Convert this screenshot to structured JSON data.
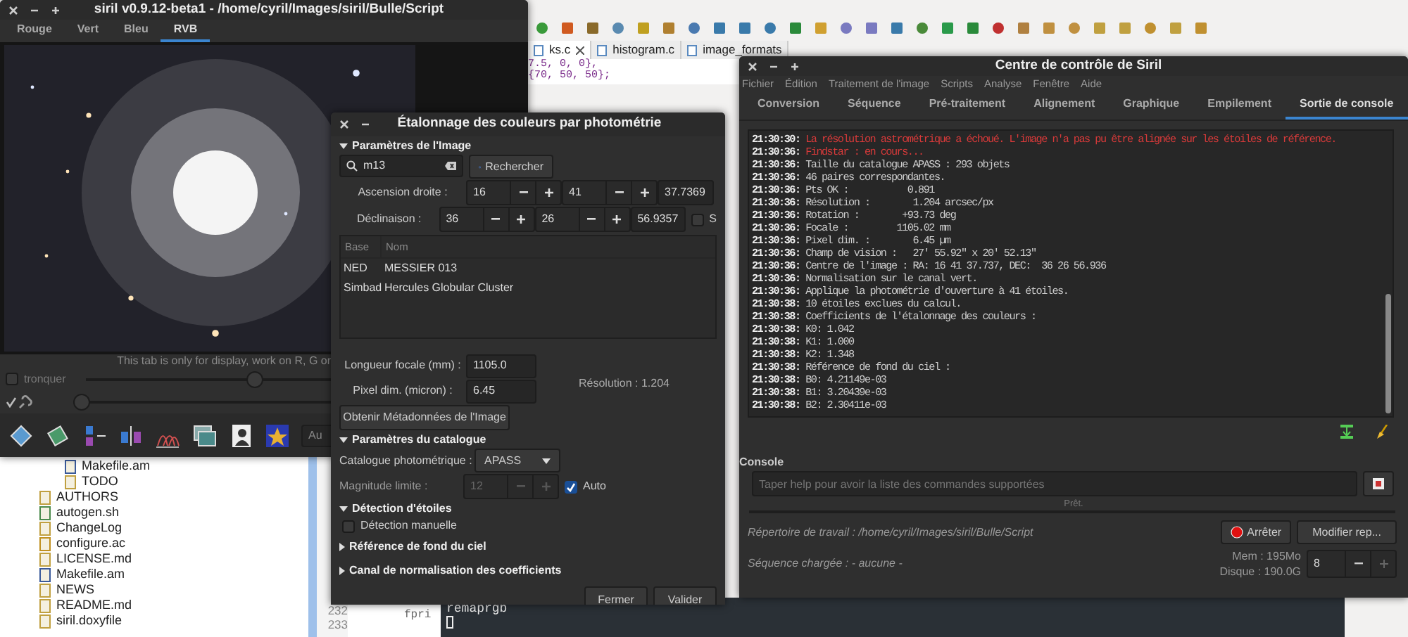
{
  "ide": {
    "editor_tabs": [
      {
        "label": "ks.c",
        "selected": true
      },
      {
        "label": "histogram.c",
        "selected": false
      },
      {
        "label": "image_formats",
        "selected": false
      }
    ],
    "code_lines": [
      "7.5, 0, 0},",
      "{70, 50, 50};"
    ],
    "file_tree": [
      {
        "children": [
          {
            "label": "Makefile.am",
            "kind": "make"
          },
          {
            "label": "TODO",
            "kind": "text"
          }
        ]
      },
      {
        "label": "AUTHORS",
        "kind": "text"
      },
      {
        "label": "autogen.sh",
        "kind": "script"
      },
      {
        "label": "ChangeLog",
        "kind": "text"
      },
      {
        "label": "configure.ac",
        "kind": "autoconf"
      },
      {
        "label": "LICENSE.md",
        "kind": "text"
      },
      {
        "label": "Makefile.am",
        "kind": "make"
      },
      {
        "label": "NEWS",
        "kind": "text"
      },
      {
        "label": "README.md",
        "kind": "text"
      },
      {
        "label": "siril.doxyfile",
        "kind": "text"
      }
    ],
    "line_numbers": [
      "232",
      "233"
    ],
    "code_fragment": "fpri",
    "terminal_lines": [
      "remaprgb"
    ]
  },
  "main_window": {
    "title": "siril v0.9.12-beta1 - /home/cyril/Images/siril/Bulle/Script",
    "tabs": [
      {
        "label": "Rouge",
        "selected": false
      },
      {
        "label": "Vert",
        "selected": false
      },
      {
        "label": "Bleu",
        "selected": false
      },
      {
        "label": "RVB",
        "selected": true
      }
    ],
    "display_note": "This tab is only for display, work on R, G or",
    "clip": {
      "label": "tronquer",
      "checked": false
    },
    "sliders": [
      {
        "level": 0.5
      },
      {
        "level": 0.0
      }
    ],
    "link": {
      "checked": true
    },
    "combo_text": "Au"
  },
  "dialog": {
    "title": "Étalonnage des couleurs par photométrie",
    "image_section": {
      "header": "Paramètres de l'Image",
      "expanded": true,
      "search_value": "m13",
      "search_button": "Rechercher",
      "coords": [
        {
          "label": "Ascension droite :",
          "values": [
            "16",
            "41",
            "37.7369"
          ]
        },
        {
          "label": "Déclinaison :",
          "values": [
            "36",
            "26",
            "56.9357"
          ],
          "south": {
            "label": "S",
            "checked": false
          }
        }
      ],
      "results": {
        "columns": [
          "Base",
          "Nom"
        ],
        "rows": [
          [
            "NED",
            "MESSIER 013"
          ],
          [
            "Simbad",
            "Hercules Globular Cluster"
          ]
        ]
      },
      "focal": {
        "label": "Longueur focale (mm) :",
        "value": "1105.0"
      },
      "pixel": {
        "label": "Pixel dim. (micron) :",
        "value": "6.45"
      },
      "resolution": "Résolution : 1.204",
      "metadata_button": "Obtenir Métadonnées de l'Image"
    },
    "catalog_section": {
      "header": "Paramètres du catalogue",
      "expanded": true,
      "catalog_label": "Catalogue photométrique :",
      "catalog_value": "APASS",
      "mag_label": "Magnitude limite :",
      "mag_value": "12",
      "mag_disabled": true,
      "auto": {
        "label": "Auto",
        "checked": true
      }
    },
    "star_section": {
      "header": "Détection d'étoiles",
      "expanded": true,
      "manual": {
        "label": "Détection manuelle",
        "checked": false
      }
    },
    "collapsed_sections": [
      {
        "header": "Référence de fond du ciel",
        "expanded": false
      },
      {
        "header": "Canal de normalisation des coefficients",
        "expanded": false
      }
    ],
    "buttons": [
      "Fermer",
      "Valider"
    ]
  },
  "control_window": {
    "title": "Centre de contrôle de Siril",
    "menu": [
      "Fichier",
      "Édition",
      "Traitement de l'image",
      "Scripts",
      "Analyse",
      "Fenêtre",
      "Aide"
    ],
    "tabs": [
      {
        "label": "Conversion",
        "selected": false
      },
      {
        "label": "Séquence",
        "selected": false
      },
      {
        "label": "Pré-traitement",
        "selected": false
      },
      {
        "label": "Alignement",
        "selected": false
      },
      {
        "label": "Graphique",
        "selected": false
      },
      {
        "label": "Empilement",
        "selected": false
      },
      {
        "label": "Sortie de console",
        "selected": true
      }
    ],
    "log": [
      {
        "time": "21:30:30:",
        "text": "La résolution astrométrique a échoué. L'image n'a pas pu être alignée sur les étoiles de référence.",
        "kind": "error"
      },
      {
        "time": "21:30:36:",
        "text": "Findstar : en cours...",
        "kind": "error"
      },
      {
        "time": "21:30:36:",
        "text": "Taille du catalogue APASS : 293 objets",
        "kind": "info"
      },
      {
        "time": "21:30:36:",
        "text": "46 paires correspondantes.",
        "kind": "info"
      },
      {
        "time": "21:30:36:",
        "text": "Pts OK :           0.891",
        "kind": "info"
      },
      {
        "time": "21:30:36:",
        "text": "Résolution :        1.204 arcsec/px",
        "kind": "info"
      },
      {
        "time": "21:30:36:",
        "text": "Rotation :        +93.73 deg",
        "kind": "info"
      },
      {
        "time": "21:30:36:",
        "text": "Focale :         1105.02 mm",
        "kind": "info"
      },
      {
        "time": "21:30:36:",
        "text": "Pixel dim. :        6.45 µm",
        "kind": "info"
      },
      {
        "time": "21:30:36:",
        "text": "Champ de vision :   27' 55.92\" x 20' 52.13\"",
        "kind": "info"
      },
      {
        "time": "21:30:36:",
        "text": "Centre de l'image : RA: 16 41 37.737, DEC:  36 26 56.936",
        "kind": "info"
      },
      {
        "time": "21:30:36:",
        "text": "Normalisation sur le canal vert.",
        "kind": "info"
      },
      {
        "time": "21:30:36:",
        "text": "Applique la photométrie d'ouverture à 41 étoiles.",
        "kind": "info"
      },
      {
        "time": "21:30:38:",
        "text": "10 étoiles exclues du calcul.",
        "kind": "info"
      },
      {
        "time": "21:30:38:",
        "text": "Coefficients de l'étalonnage des couleurs :",
        "kind": "info"
      },
      {
        "time": "21:30:38:",
        "text": "K0: 1.042",
        "kind": "info"
      },
      {
        "time": "21:30:38:",
        "text": "K1: 1.000",
        "kind": "info"
      },
      {
        "time": "21:30:38:",
        "text": "K2: 1.348",
        "kind": "info"
      },
      {
        "time": "21:30:38:",
        "text": "Référence de fond du ciel :",
        "kind": "info"
      },
      {
        "time": "21:30:38:",
        "text": "B0: 4.21149e-03",
        "kind": "info"
      },
      {
        "time": "21:30:38:",
        "text": "B1: 3.20439e-03",
        "kind": "info"
      },
      {
        "time": "21:30:38:",
        "text": "B2: 2.30411e-03",
        "kind": "info"
      }
    ],
    "console_label": "Console",
    "console_placeholder": "Taper help pour avoir la liste des commandes supportées",
    "status": "Prêt.",
    "workdir": "Répertoire de travail : /home/cyril/Images/siril/Bulle/Script",
    "stop_button": "Arrêter",
    "change_button": "Modifier rep...",
    "sequence": "Séquence chargée : - aucune -",
    "mem": "Mem : 195Mo",
    "disk": "Disque : 190.0G",
    "threads": "8"
  }
}
